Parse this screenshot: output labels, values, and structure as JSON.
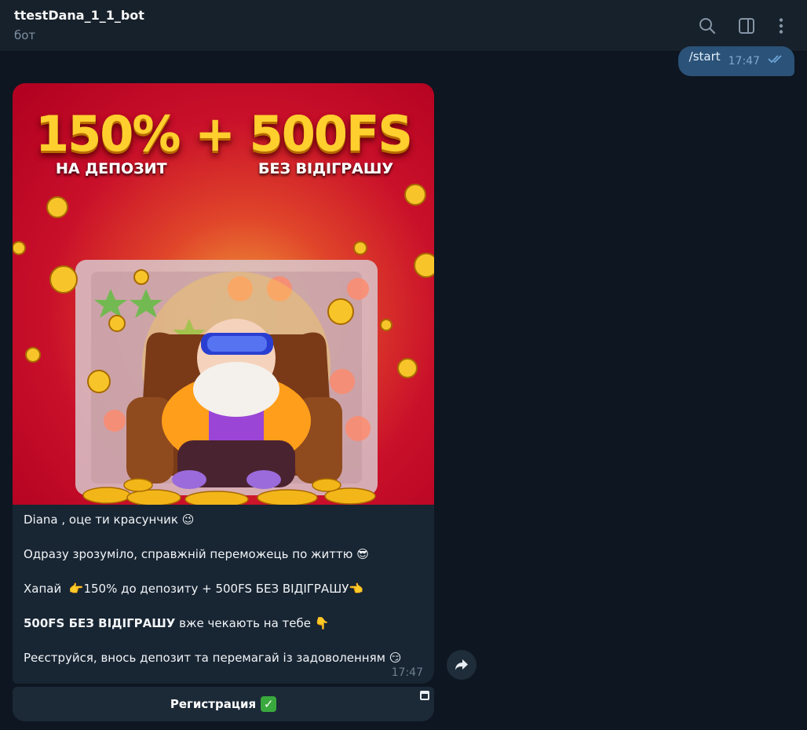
{
  "header": {
    "title": "ttestDana_1_1_bot",
    "subtitle": "бот"
  },
  "outgoing": {
    "text": "/start",
    "time": "17:47"
  },
  "incoming": {
    "image": {
      "headline": "150% + 500FS",
      "sub_left": "НА ДЕПОЗИТ",
      "sub_right": "БЕЗ ВІДІГРАШУ"
    },
    "lines": [
      {
        "text": "Diana , оце ти красунчик",
        "emoji": "😉"
      },
      {
        "text": "Одразу зрозуміло, справжній переможець по життю",
        "emoji": "😎"
      },
      {
        "pre": "Хапай ",
        "emoji_pre": "👉",
        "text": "150% до депозиту + 500FS БЕЗ ВІДІГРАШУ",
        "emoji": "👈"
      },
      {
        "bold": "500FS БЕЗ ВІДІГРАШУ",
        "text": " вже чекають на тебе ",
        "emoji": "👇"
      },
      {
        "text": "Реєструйся, внось депозит та перемагай із задоволенням",
        "emoji": "😏"
      }
    ],
    "time": "17:47",
    "button_label": "Регистрация",
    "button_emoji": "✓"
  },
  "icons": [
    "search-icon",
    "sidebar-toggle-icon",
    "more-vertical-icon",
    "double-check-icon",
    "forward-icon",
    "web-app-icon"
  ],
  "colors": {
    "background": "#0e1621",
    "header": "#17212b",
    "outgoing_bubble": "#2b5278",
    "incoming_bubble": "#182533"
  }
}
